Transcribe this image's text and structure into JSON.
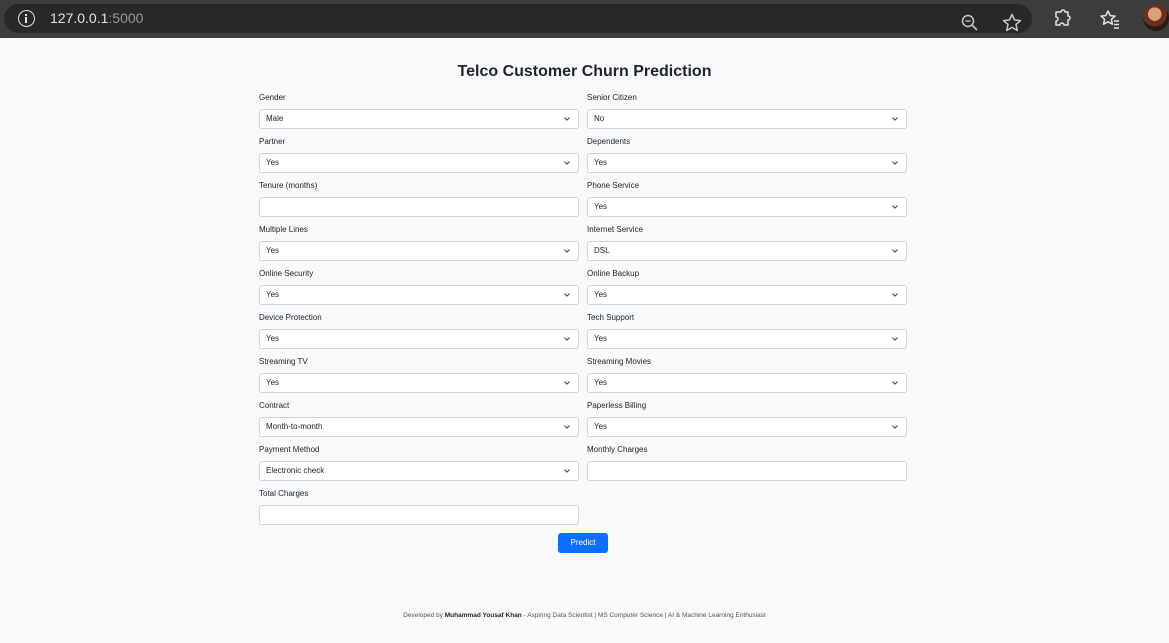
{
  "browser": {
    "url_host": "127.0.0.1",
    "url_port": ":5000",
    "icons": [
      "info-icon",
      "zoom-out-icon",
      "bookmark-star-icon",
      "extensions-icon",
      "favorites-icon",
      "profile-avatar"
    ]
  },
  "page": {
    "title": "Telco Customer Churn Prediction"
  },
  "form": {
    "gender": {
      "label": "Gender",
      "value": "Male"
    },
    "senior_citizen": {
      "label": "Senior Citizen",
      "value": "No"
    },
    "partner": {
      "label": "Partner",
      "value": "Yes"
    },
    "dependents": {
      "label": "Dependents",
      "value": "Yes"
    },
    "tenure": {
      "label": "Tenure (months)",
      "value": ""
    },
    "phone_service": {
      "label": "Phone Service",
      "value": "Yes"
    },
    "multiple_lines": {
      "label": "Multiple Lines",
      "value": "Yes"
    },
    "internet_service": {
      "label": "Internet Service",
      "value": "DSL"
    },
    "online_security": {
      "label": "Online Security",
      "value": "Yes"
    },
    "online_backup": {
      "label": "Online Backup",
      "value": "Yes"
    },
    "device_protection": {
      "label": "Device Protection",
      "value": "Yes"
    },
    "tech_support": {
      "label": "Tech Support",
      "value": "Yes"
    },
    "streaming_tv": {
      "label": "Streaming TV",
      "value": "Yes"
    },
    "streaming_movies": {
      "label": "Streaming Movies",
      "value": "Yes"
    },
    "contract": {
      "label": "Contract",
      "value": "Month-to-month"
    },
    "paperless_billing": {
      "label": "Paperless Billing",
      "value": "Yes"
    },
    "payment_method": {
      "label": "Payment Method",
      "value": "Electronic check"
    },
    "monthly_charges": {
      "label": "Monthly Charges",
      "value": ""
    },
    "total_charges": {
      "label": "Total Charges",
      "value": ""
    },
    "predict_label": "Predict"
  },
  "footer": {
    "prefix": "Developed by",
    "author": "Muhammad Yousaf Khan",
    "suffix": "- Aspiring Data Scientist | MS Computer Science | AI & Machine Learning Enthusiast"
  },
  "colors": {
    "primary": "#0d6efd",
    "page_bg": "#f8f9fa",
    "chrome_bg": "#3c3c3c"
  }
}
